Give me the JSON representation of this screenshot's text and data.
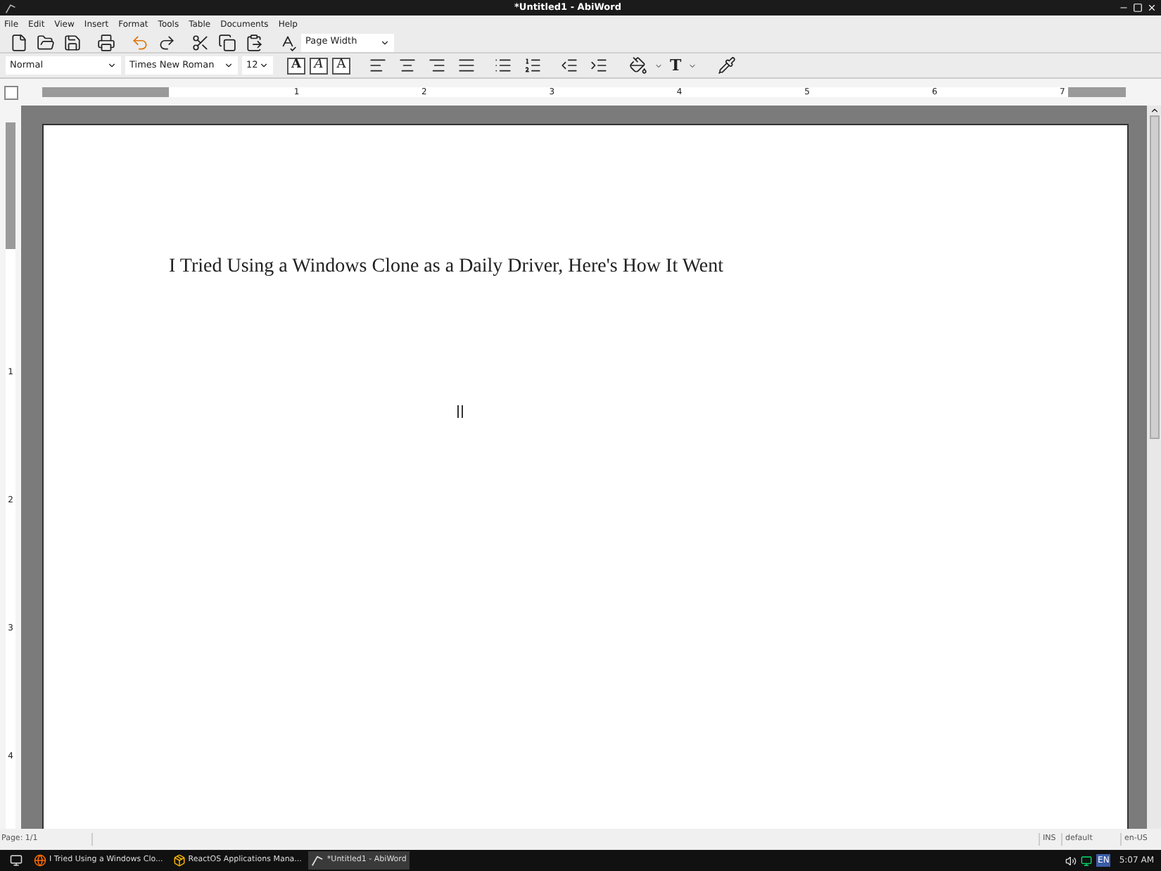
{
  "window": {
    "title": "*Untitled1 - AbiWord"
  },
  "menu": [
    "File",
    "Edit",
    "View",
    "Insert",
    "Format",
    "Tools",
    "Table",
    "Documents",
    "Help"
  ],
  "toolbar": {
    "zoom": "Page Width",
    "style": "Normal",
    "font": "Times New Roman",
    "size": "12",
    "format_buttons": [
      {
        "glyph": "A",
        "kind": "bold"
      },
      {
        "glyph": "A",
        "kind": "italic"
      },
      {
        "glyph": "A",
        "kind": "outline"
      }
    ],
    "text_color_glyph": "T"
  },
  "ruler": {
    "horizontal": [
      "1",
      "2",
      "3",
      "4",
      "5",
      "6",
      "7"
    ],
    "vertical": [
      "1",
      "2",
      "3",
      "4"
    ]
  },
  "document": {
    "text": "I Tried Using a Windows Clone as a Daily Driver, Here's How It Went"
  },
  "status_bar": {
    "page": "Page: 1/1",
    "mode": "INS",
    "style": "default",
    "language": "en-US"
  },
  "taskbar": {
    "items": [
      {
        "label": "I Tried Using a Windows Clo...",
        "kind": "browser",
        "selected": false
      },
      {
        "label": "ReactOS Applications Mana...",
        "kind": "package",
        "selected": false
      },
      {
        "label": "*Untitled1 - AbiWord",
        "kind": "abiword",
        "selected": true
      }
    ],
    "tray_language": "EN",
    "clock": "5:07 AM"
  }
}
